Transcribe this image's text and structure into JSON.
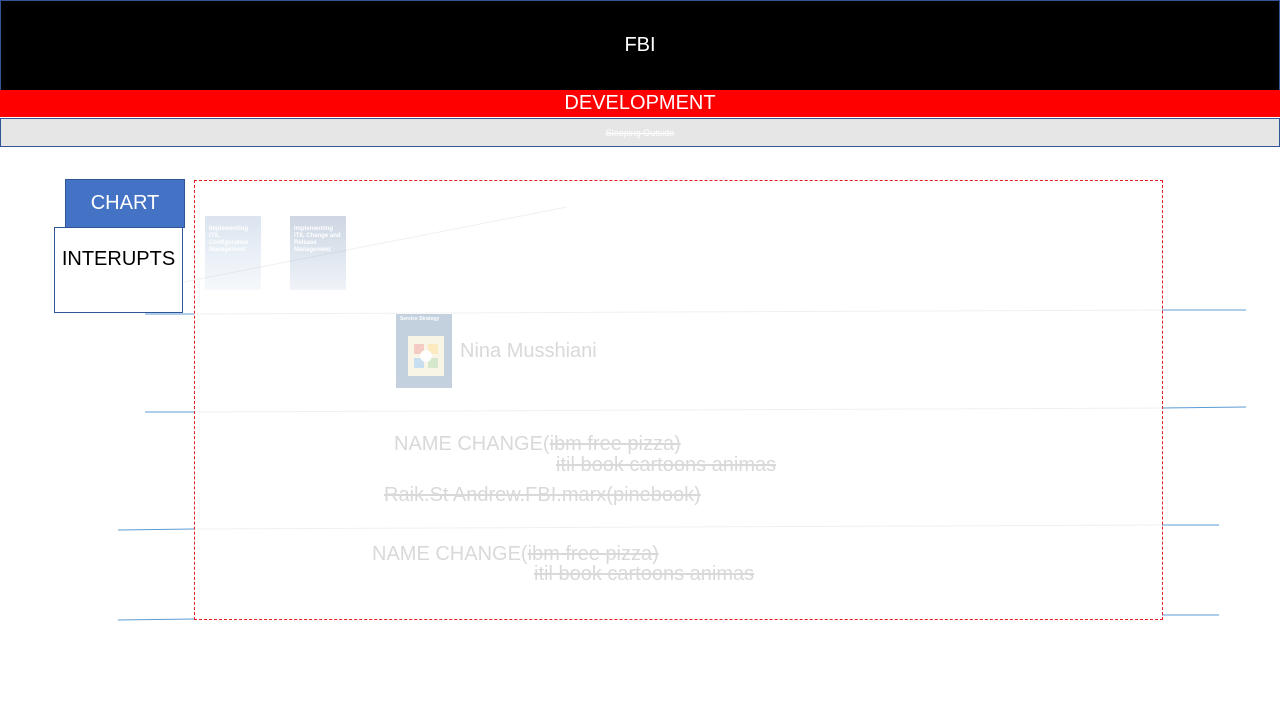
{
  "header": {
    "title": "FBI",
    "subtitle": "DEVELOPMENT",
    "strip_text": "Sleeping Outside"
  },
  "buttons": {
    "chart_label": "CHART",
    "interrupts_label": "INTERUPTS"
  },
  "books": [
    {
      "title": "Implementing ITIL Configuration Management",
      "icon": "book-cover-icon"
    },
    {
      "title": "Implementing ITIL Change and Release Management",
      "icon": "book-cover-icon"
    },
    {
      "title": "Service Strategy",
      "icon": "book-cover-icon"
    }
  ],
  "person": {
    "name": "Nina Musshiani"
  },
  "entries": [
    {
      "lead": "NAME CHANGE(",
      "struck": "ibm free pizza)",
      "sub": "itil book cartoons animas"
    },
    {
      "lead": "",
      "struck": "Raik.St Andrew.FBI.marx(pinebook)",
      "sub": ""
    },
    {
      "lead": "NAME CHANGE(",
      "struck": "ibm free pizza)",
      "sub": "itil book cartoons animas"
    }
  ],
  "colors": {
    "header_bg": "#000000",
    "banner_red": "#ff0000",
    "strip_grey": "#e6e6e6",
    "accent_blue": "#4472c4",
    "frame_red": "#e31b23",
    "line_blue": "#5b9bd5"
  }
}
